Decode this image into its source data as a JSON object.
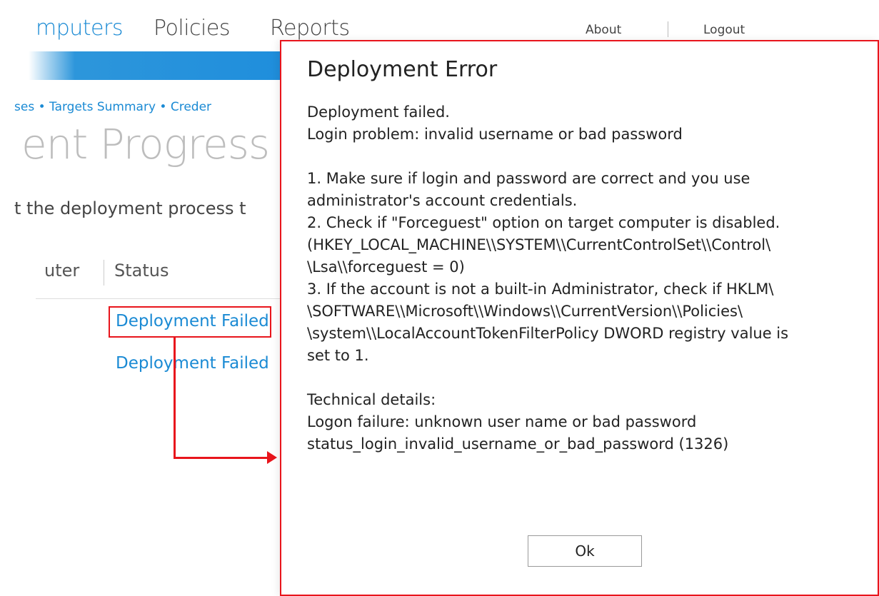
{
  "nav": {
    "computers": "mputers",
    "policies": "Policies",
    "reports": "Reports",
    "about": "About",
    "logout": "Logout"
  },
  "breadcrumb": "ses • Targets Summary • Creder",
  "page_title": "ent Progress",
  "page_description": "t the deployment process t",
  "table": {
    "headers": {
      "computer": "uter",
      "status": "Status"
    },
    "rows": [
      {
        "status": "Deployment Failed"
      },
      {
        "status": "Deployment Failed"
      }
    ]
  },
  "dialog": {
    "title": "Deployment Error",
    "lines": [
      "Deployment failed.",
      "Login problem: invalid username or bad password",
      "",
      "1. Make sure if login and password are correct and you use",
      "administrator's account credentials.",
      "2. Check if \"Forceguest\" option on target computer is disabled.",
      "(HKEY_LOCAL_MACHINE\\\\SYSTEM\\\\CurrentControlSet\\\\Control\\",
      "\\Lsa\\\\forceguest = 0)",
      "3. If the account is not a built-in Administrator, check if HKLM\\",
      "\\SOFTWARE\\\\Microsoft\\\\Windows\\\\CurrentVersion\\\\Policies\\",
      "\\system\\\\LocalAccountTokenFilterPolicy DWORD registry value is",
      "set to 1.",
      "",
      "Technical details:",
      "Logon failure: unknown user name or bad password",
      "status_login_invalid_username_or_bad_password (1326)"
    ],
    "ok_label": "Ok"
  },
  "colors": {
    "accent": "#1a8ad4",
    "highlight": "#e8151c"
  }
}
